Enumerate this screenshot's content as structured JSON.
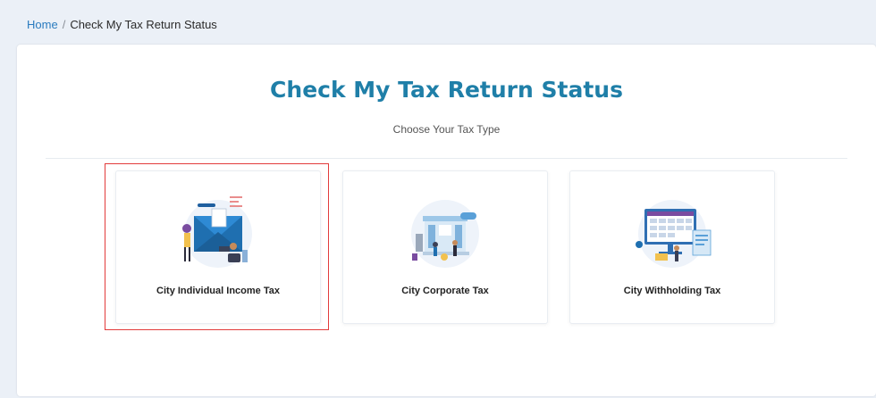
{
  "breadcrumb": {
    "home": "Home",
    "separator": "/",
    "current": "Check My Tax Return Status"
  },
  "page": {
    "title": "Check My Tax Return Status",
    "subtitle": "Choose Your Tax Type"
  },
  "cards": [
    {
      "label": "City Individual Income Tax",
      "icon": "envelope-illustration-icon",
      "selected": true
    },
    {
      "label": "City Corporate Tax",
      "icon": "corporate-building-illustration-icon",
      "selected": false
    },
    {
      "label": "City Withholding Tax",
      "icon": "calendar-monitor-illustration-icon",
      "selected": false
    }
  ],
  "colors": {
    "accent": "#1f7fa8",
    "link": "#2a7bbf",
    "highlight": "#e23b3b",
    "background": "#ebf0f7"
  }
}
